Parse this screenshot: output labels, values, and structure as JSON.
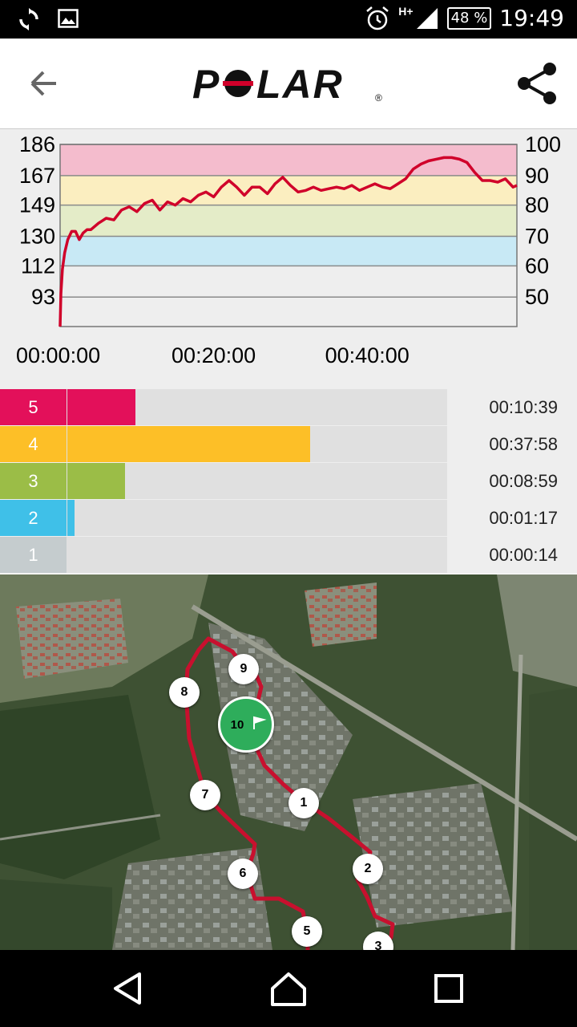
{
  "status_bar": {
    "icons_left": [
      "sync-icon",
      "image-icon"
    ],
    "icons_right": [
      "alarm-icon",
      "signal-hplus-icon"
    ],
    "network_label": "H+",
    "battery": "48 %",
    "time": "19:49"
  },
  "header": {
    "logo_text": "POLAR",
    "logo_mark": "®",
    "back_icon": "arrow-left-icon",
    "share_icon": "share-icon",
    "brand_color": "#c0001f"
  },
  "chart_data": {
    "type": "line",
    "left_axis_ticks": [
      "186",
      "167",
      "149",
      "130",
      "112",
      "93"
    ],
    "right_axis_ticks": [
      "100",
      "90",
      "80",
      "70",
      "60",
      "50"
    ],
    "x_ticks": [
      "00:00:00",
      "00:20:00",
      "00:40:00"
    ],
    "ylim": [
      75,
      186
    ],
    "xlim_minutes": [
      0,
      59.5
    ],
    "zone_bands": [
      {
        "from": 167,
        "to": 186,
        "color": "#f4bccd"
      },
      {
        "from": 149,
        "to": 167,
        "color": "#fbeec0"
      },
      {
        "from": 130,
        "to": 149,
        "color": "#e4ecc8"
      },
      {
        "from": 112,
        "to": 130,
        "color": "#c8e9f5"
      }
    ],
    "series": [
      {
        "color": "#d0002a",
        "x": [
          0,
          0.1,
          0.3,
          0.6,
          1.0,
          1.5,
          2.0,
          2.5,
          3.0,
          3.5,
          4.0,
          5.0,
          6.0,
          7.0,
          8.0,
          9.0,
          10.0,
          11.0,
          12.0,
          13.0,
          14.0,
          15.0,
          16.0,
          17.0,
          18.0,
          19.0,
          20.0,
          21.0,
          22.0,
          23.0,
          24.0,
          25.0,
          26.0,
          27.0,
          28.0,
          29.0,
          30.0,
          31.0,
          32.0,
          33.0,
          34.0,
          35.0,
          36.0,
          37.0,
          38.0,
          39.0,
          40.0,
          41.0,
          42.0,
          43.0,
          44.0,
          45.0,
          46.0,
          47.0,
          48.0,
          49.0,
          50.0,
          51.0,
          52.0,
          53.0,
          54.0,
          55.0,
          56.0,
          57.0,
          58.0,
          59.0,
          59.5
        ],
        "y": [
          75,
          95,
          110,
          120,
          128,
          133,
          133,
          128,
          132,
          134,
          134,
          138,
          141,
          140,
          146,
          148,
          145,
          150,
          152,
          146,
          151,
          149,
          153,
          151,
          155,
          157,
          154,
          160,
          164,
          160,
          155,
          160,
          160,
          156,
          162,
          166,
          161,
          157,
          158,
          160,
          158,
          159,
          160,
          159,
          161,
          158,
          160,
          162,
          160,
          159,
          162,
          165,
          171,
          174,
          176,
          177,
          178,
          178,
          177,
          175,
          169,
          164,
          164,
          163,
          165,
          160,
          161
        ]
      }
    ]
  },
  "zones": [
    {
      "number": "5",
      "color": "#e3105a",
      "fraction": 0.18,
      "time": "00:10:39"
    },
    {
      "number": "4",
      "color": "#fdbf27",
      "fraction": 0.64,
      "time": "00:37:58"
    },
    {
      "number": "3",
      "color": "#9bbd47",
      "fraction": 0.152,
      "time": "00:08:59"
    },
    {
      "number": "2",
      "color": "#3fc0e8",
      "fraction": 0.02,
      "time": "00:01:17"
    },
    {
      "number": "1",
      "color": "#c5ccce",
      "fraction": 0.0,
      "time": "00:00:14"
    }
  ],
  "map": {
    "route_color": "#c8102e",
    "laps": [
      {
        "label": "1"
      },
      {
        "label": "2"
      },
      {
        "label": "3"
      },
      {
        "label": "5"
      },
      {
        "label": "6"
      },
      {
        "label": "7"
      },
      {
        "label": "8"
      },
      {
        "label": "9"
      }
    ],
    "finish": {
      "label": "10",
      "icon": "finish-flag-icon",
      "color": "#2ead5b"
    }
  },
  "nav": {
    "back": "nav-back-icon",
    "home": "nav-home-icon",
    "recents": "nav-recents-icon"
  }
}
